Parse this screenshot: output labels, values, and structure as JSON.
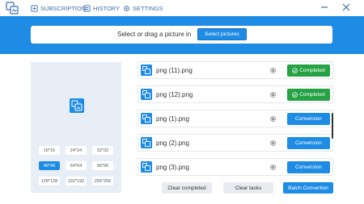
{
  "nav": {
    "subscription": "SUBSCRIPTION",
    "history": "HISTORY",
    "settings": "SETTINGS"
  },
  "select_bar": {
    "prompt": "Select or drag a picture in",
    "button": "Select pictures"
  },
  "sizes": [
    {
      "label": "16*16",
      "active": false
    },
    {
      "label": "24*24",
      "active": false
    },
    {
      "label": "32*32",
      "active": false
    },
    {
      "label": "48*48",
      "active": true
    },
    {
      "label": "64*64",
      "active": false
    },
    {
      "label": "96*96",
      "active": false
    },
    {
      "label": "128*128",
      "active": false
    },
    {
      "label": "192*192",
      "active": false
    },
    {
      "label": "256*256",
      "active": false
    }
  ],
  "files": [
    {
      "name": "png (11).png",
      "status": "Completed"
    },
    {
      "name": "png (12).png",
      "status": "Completed"
    },
    {
      "name": "png (1).png",
      "status": "Conversion"
    },
    {
      "name": "png (2).png",
      "status": "Conversion"
    },
    {
      "name": "png (3).png",
      "status": "Conversion"
    }
  ],
  "actions": {
    "clear_completed": "Clear completed",
    "clear_tasks": "Clear tasks",
    "batch_convert": "Batch Convertion"
  },
  "colors": {
    "accent": "#1e8be5",
    "completed": "#25a244",
    "preview_bg": "#e7eef6"
  }
}
